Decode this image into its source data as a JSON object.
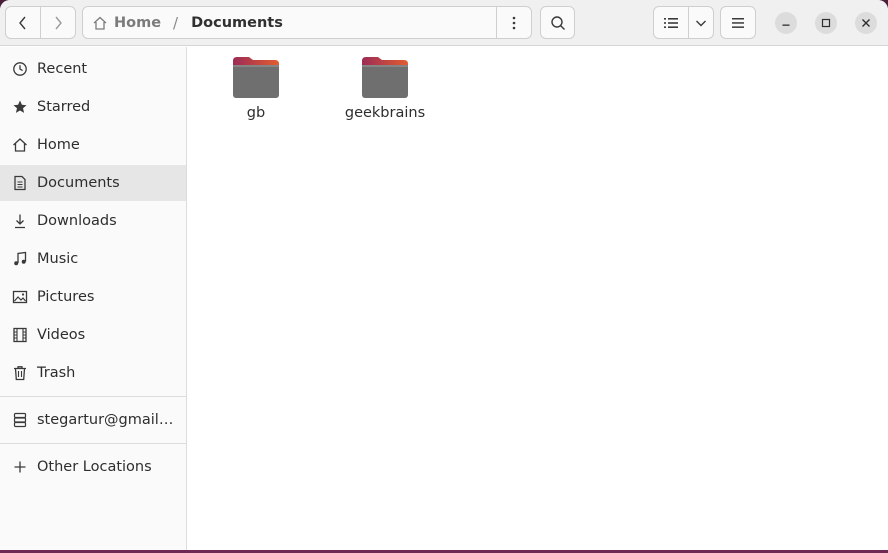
{
  "headerbar": {
    "breadcrumb": [
      {
        "label": "Home",
        "icon": "home-icon"
      },
      {
        "label": "Documents"
      }
    ],
    "separator": "/",
    "icons": {
      "back": "chevron-left-icon",
      "forward": "chevron-right-icon",
      "path_menu": "vertical-dots-icon",
      "search": "search-icon",
      "view_list": "list-view-icon",
      "view_options": "chevron-down-icon",
      "main_menu": "hamburger-icon",
      "minimize": "minimize-icon",
      "maximize": "maximize-icon",
      "close": "close-icon"
    }
  },
  "sidebar": {
    "items": [
      {
        "label": "Recent",
        "icon": "clock-icon"
      },
      {
        "label": "Starred",
        "icon": "star-icon"
      },
      {
        "label": "Home",
        "icon": "home-icon"
      },
      {
        "label": "Documents",
        "icon": "document-icon",
        "active": true
      },
      {
        "label": "Downloads",
        "icon": "download-icon"
      },
      {
        "label": "Music",
        "icon": "music-note-icon"
      },
      {
        "label": "Pictures",
        "icon": "picture-icon"
      },
      {
        "label": "Videos",
        "icon": "film-icon"
      },
      {
        "label": "Trash",
        "icon": "trash-icon"
      }
    ],
    "account": {
      "label": "stegartur@gmail.com",
      "icon": "network-drive-icon"
    },
    "other_locations": {
      "label": "Other Locations",
      "icon": "plus-icon"
    }
  },
  "files": [
    {
      "name": "gb",
      "icon": "folder-icon"
    },
    {
      "name": "geekbrains",
      "icon": "folder-icon"
    }
  ],
  "colors": {
    "folder_body": "#6f6f6f",
    "folder_tab_start": "#9c2b57",
    "folder_tab_end": "#e25d2f",
    "active_row": "#e6e6e6",
    "desktop_bg": "#4a1d3a"
  }
}
